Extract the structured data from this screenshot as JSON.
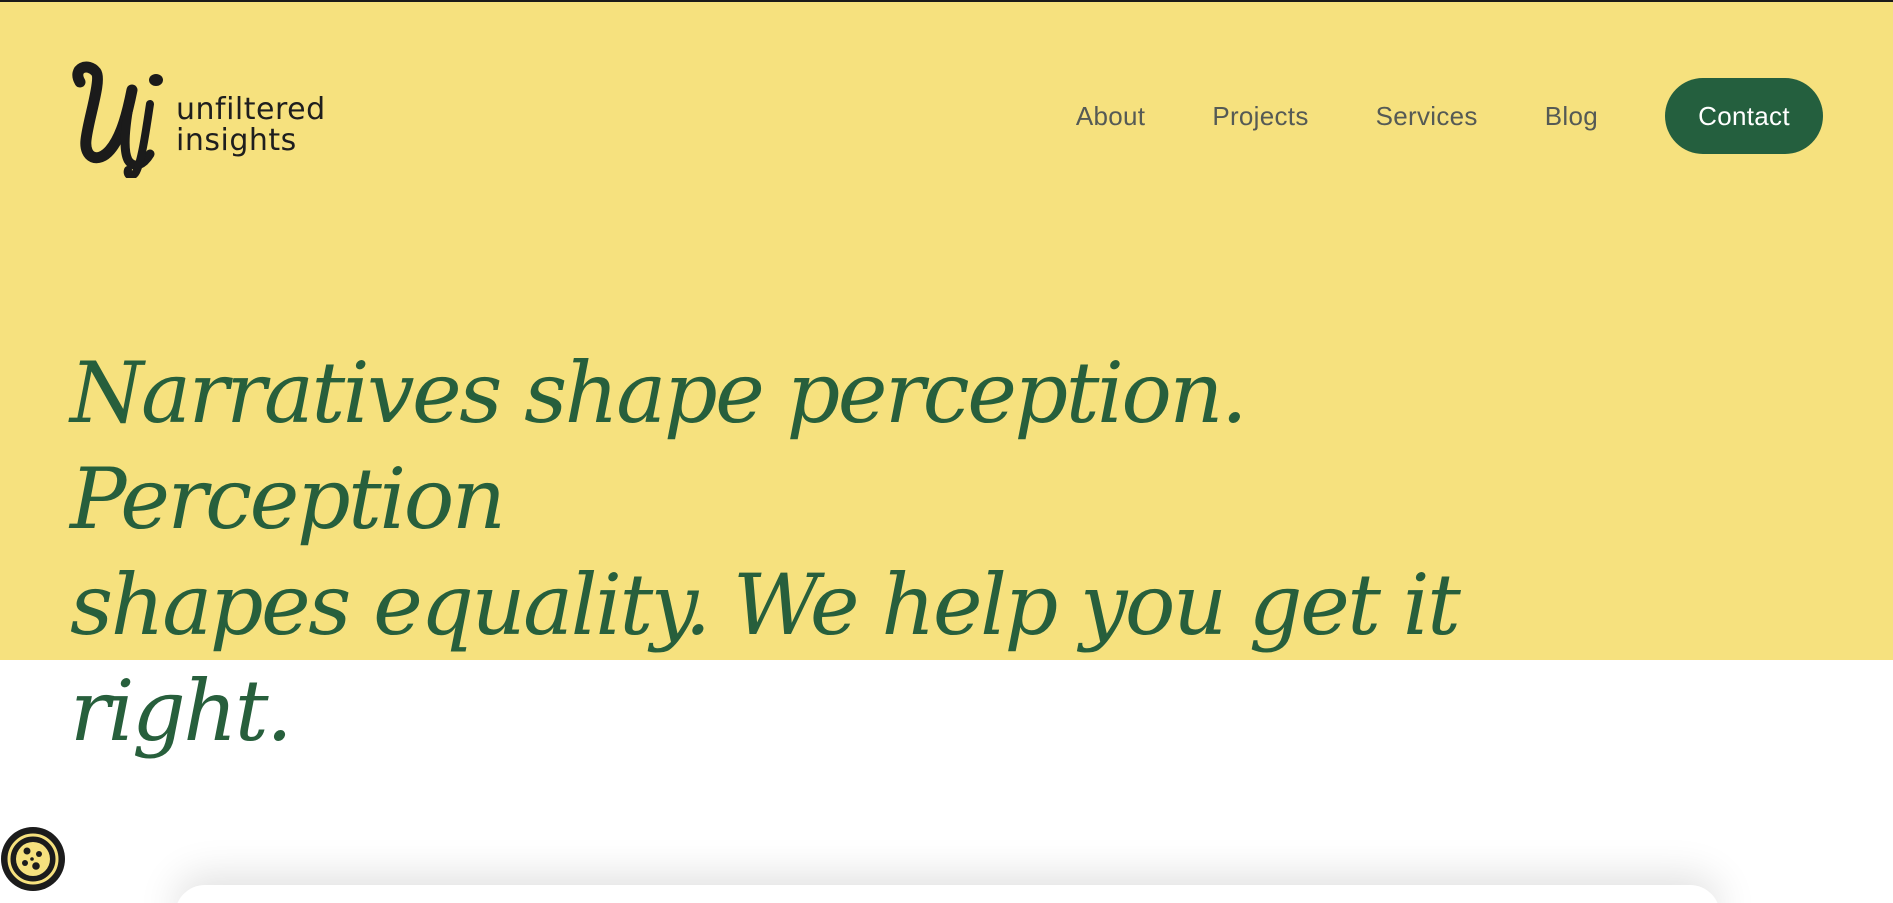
{
  "brand": {
    "line1": "unfiltered",
    "line2": "insights",
    "mark_letter": "Ui"
  },
  "nav": {
    "items": [
      {
        "label": "About"
      },
      {
        "label": "Projects"
      },
      {
        "label": "Services"
      },
      {
        "label": "Blog"
      }
    ],
    "contact_label": "Contact"
  },
  "hero": {
    "headline_line1": "Narratives shape perception. Perception",
    "headline_line2": "shapes equality. We help you get it right."
  },
  "colors": {
    "hero_background": "#f6e17e",
    "accent_green": "#245f3e",
    "headline_green": "#275f3c",
    "nav_text": "#555a55"
  },
  "icons": {
    "cookie": "cookie-icon"
  }
}
